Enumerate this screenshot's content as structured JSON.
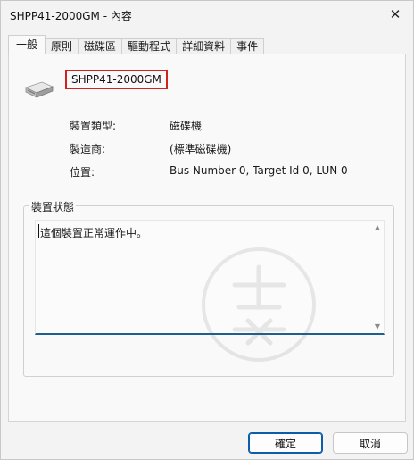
{
  "window": {
    "title": "SHPP41-2000GM - 內容",
    "close_glyph": "✕"
  },
  "tabs": [
    {
      "label": "一般",
      "active": true
    },
    {
      "label": "原則",
      "active": false
    },
    {
      "label": "磁碟區",
      "active": false
    },
    {
      "label": "驅動程式",
      "active": false
    },
    {
      "label": "詳細資料",
      "active": false
    },
    {
      "label": "事件",
      "active": false
    }
  ],
  "device": {
    "name": "SHPP41-2000GM",
    "icon": "disk-drive-icon"
  },
  "properties": [
    {
      "label": "裝置類型:",
      "value": "磁碟機"
    },
    {
      "label": "製造商:",
      "value": "(標準磁碟機)"
    },
    {
      "label": "位置:",
      "value": "Bus Number 0, Target Id 0, LUN 0"
    }
  ],
  "status": {
    "legend": "裝置狀態",
    "text": "這個裝置正常運作中。"
  },
  "buttons": {
    "ok": "確定",
    "cancel": "取消"
  },
  "colors": {
    "highlight_border": "#d32020",
    "focus_underline": "#1f5f8f",
    "ok_border": "#0b5cab"
  }
}
